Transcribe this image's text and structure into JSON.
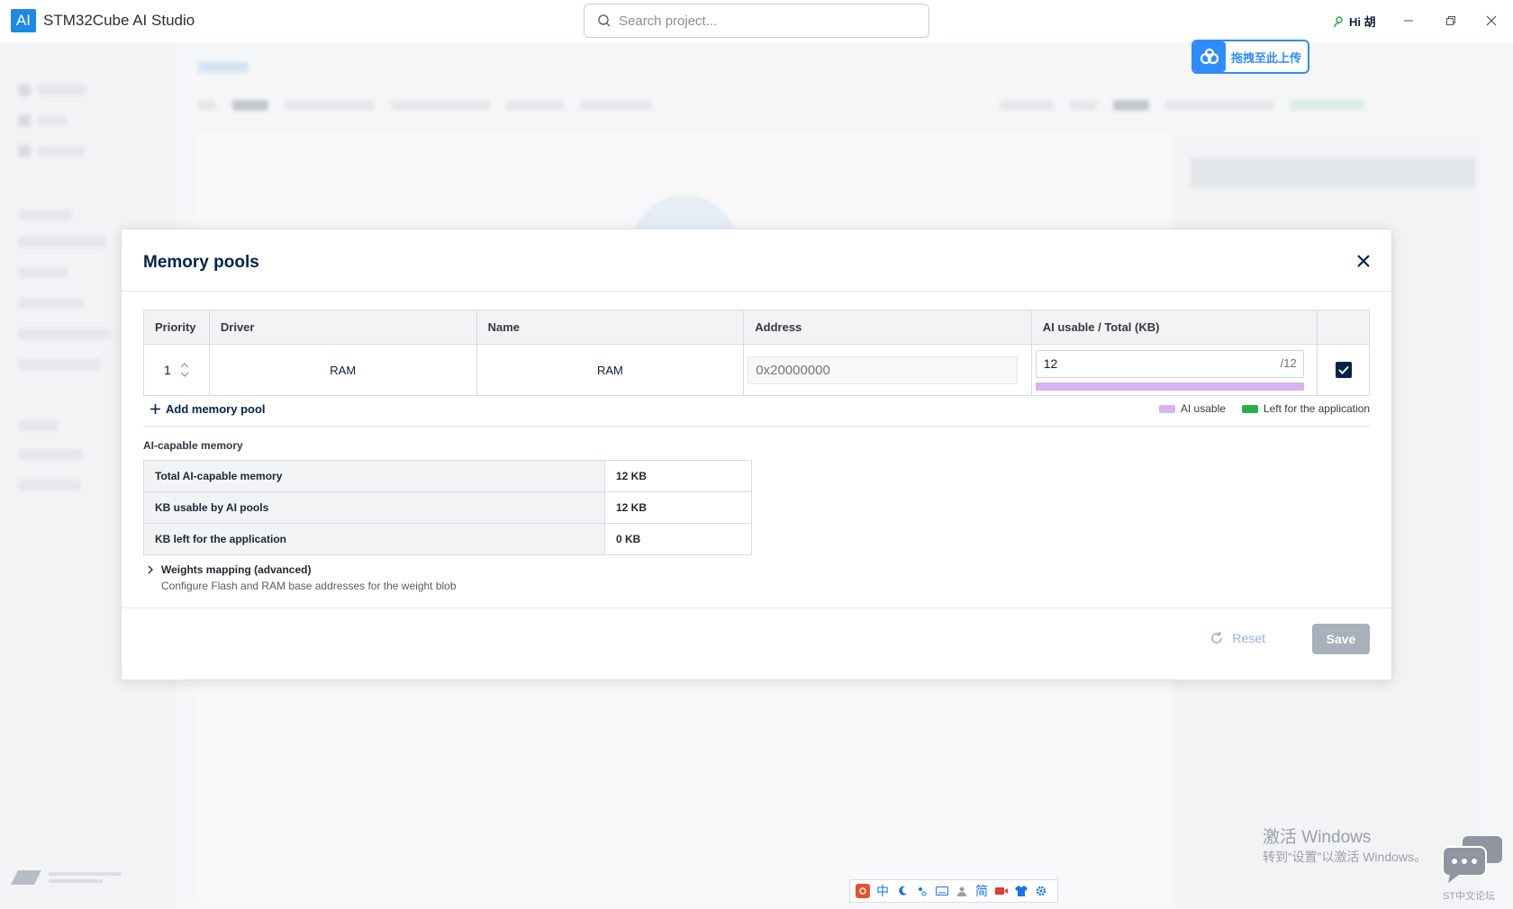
{
  "app": {
    "logo": "AI",
    "title": "STM32Cube AI Studio",
    "search_placeholder": "Search project...",
    "user_greeting": "Hi 胡"
  },
  "upload_badge": {
    "label": "拖拽至此上传"
  },
  "modal": {
    "title": "Memory pools",
    "table": {
      "headers": [
        "Priority",
        "Driver",
        "Name",
        "Address",
        "AI usable / Total (KB)",
        ""
      ],
      "rows": [
        {
          "priority": "1",
          "driver": "RAM",
          "name": "RAM",
          "address_placeholder": "0x20000000",
          "ai_usable": "12",
          "total": "/12",
          "enabled": true,
          "ai_usable_fraction": 1.0
        }
      ]
    },
    "add_pool_label": "Add memory pool",
    "legend": {
      "ai_usable": "AI usable",
      "left_for_app": "Left for the application",
      "ai_color": "#d6b4f0",
      "app_color": "#24b14c"
    },
    "ai_capable": {
      "title": "AI-capable memory",
      "rows": [
        {
          "label": "Total AI-capable memory",
          "value": "12 KB"
        },
        {
          "label": "KB usable by AI pools",
          "value": "12 KB"
        },
        {
          "label": "KB left for the application",
          "value": "0 KB"
        }
      ]
    },
    "weights": {
      "title": "Weights mapping (advanced)",
      "description": "Configure Flash and RAM base addresses for the weight blob"
    },
    "footer": {
      "reset_label": "Reset",
      "save_label": "Save"
    }
  },
  "watermark": {
    "line1": "激活 Windows",
    "line2": "转到“设置”以激活 Windows。",
    "forum": "ST中文论坛"
  },
  "ime": {
    "lang": "中",
    "simplified": "简"
  },
  "colors": {
    "accent": "#03234b",
    "brand": "#1e88e5"
  }
}
